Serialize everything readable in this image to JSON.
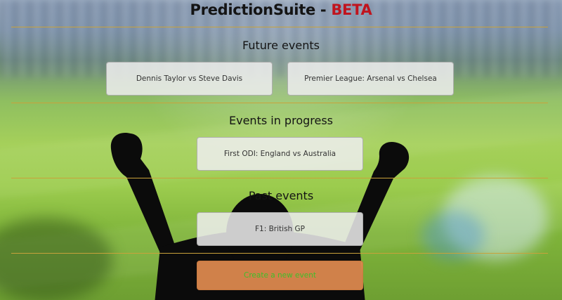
{
  "app": {
    "title_main": "PredictionSuite - ",
    "title_badge": "BETA"
  },
  "sections": {
    "future": {
      "heading": "Future events",
      "events": [
        "Dennis Taylor vs Steve Davis",
        "Premier League: Arsenal vs Chelsea"
      ]
    },
    "in_progress": {
      "heading": "Events in progress",
      "events": [
        "First ODI: England vs Australia"
      ]
    },
    "past": {
      "heading": "Past events",
      "events": [
        "F1: British GP"
      ]
    }
  },
  "actions": {
    "create_label": "Create a new event"
  },
  "colors": {
    "beta": "#c0141e",
    "divider": "#c9a23a",
    "create_button_bg": "#e28c50",
    "create_button_text": "#3fbf2a"
  }
}
